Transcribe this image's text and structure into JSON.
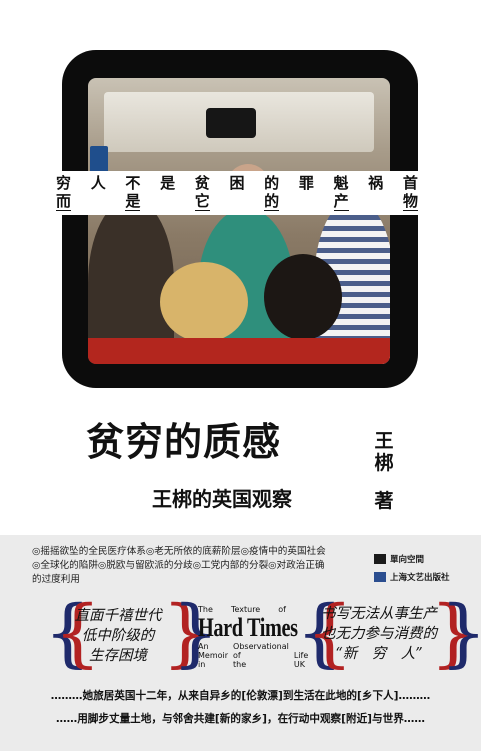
{
  "cover": {
    "band_line1": [
      "穷",
      "人",
      "不",
      "是",
      "贫",
      "困",
      "的",
      "罪",
      "魁",
      "祸",
      "首"
    ],
    "band_line2": [
      "而",
      "是",
      "它",
      "的",
      "产",
      "物"
    ]
  },
  "book": {
    "title": "贫穷的质感",
    "subtitle": "王梆的英国观察",
    "author_chars": [
      "王",
      "梆"
    ],
    "author_role": "著"
  },
  "back": {
    "blurb": "◎摇摇欲坠的全民医疗体系◎老无所依的底薪阶层◎疫情中的英国社会◎全球化的陷阱◎脱欧与留欧派的分歧◎工党内部的分裂◎对政治正确的过度利用",
    "publishers": [
      "單向空間",
      "上海文艺出版社"
    ],
    "left_quote": [
      "直面千禧世代",
      "低中阶级的",
      "生存困境"
    ],
    "right_quote": [
      "书写无法从事生产",
      "也无力参与消费的",
      "“新　穷　人”"
    ],
    "english": {
      "line1": [
        "The",
        "Texture",
        "of"
      ],
      "big": "Hard Times",
      "grid": [
        "An",
        "Observational",
        "",
        "Memoir",
        "of",
        "Life",
        "in",
        "the",
        "UK"
      ]
    },
    "tagline1": "………她旅居英国十二年，从来自异乡的[伦敦漂]到生活在此地的[乡下人]………",
    "tagline2": "……用脚步丈量土地，与邻舍共建[新的家乡]，在行动中观察[附近]与世界……"
  },
  "colors": {
    "frame": "#0c0c0c",
    "panel": "#ebebeb",
    "brace_blue": "#1f2a6b",
    "brace_red": "#b22222",
    "sill_red": "#b3261e"
  }
}
